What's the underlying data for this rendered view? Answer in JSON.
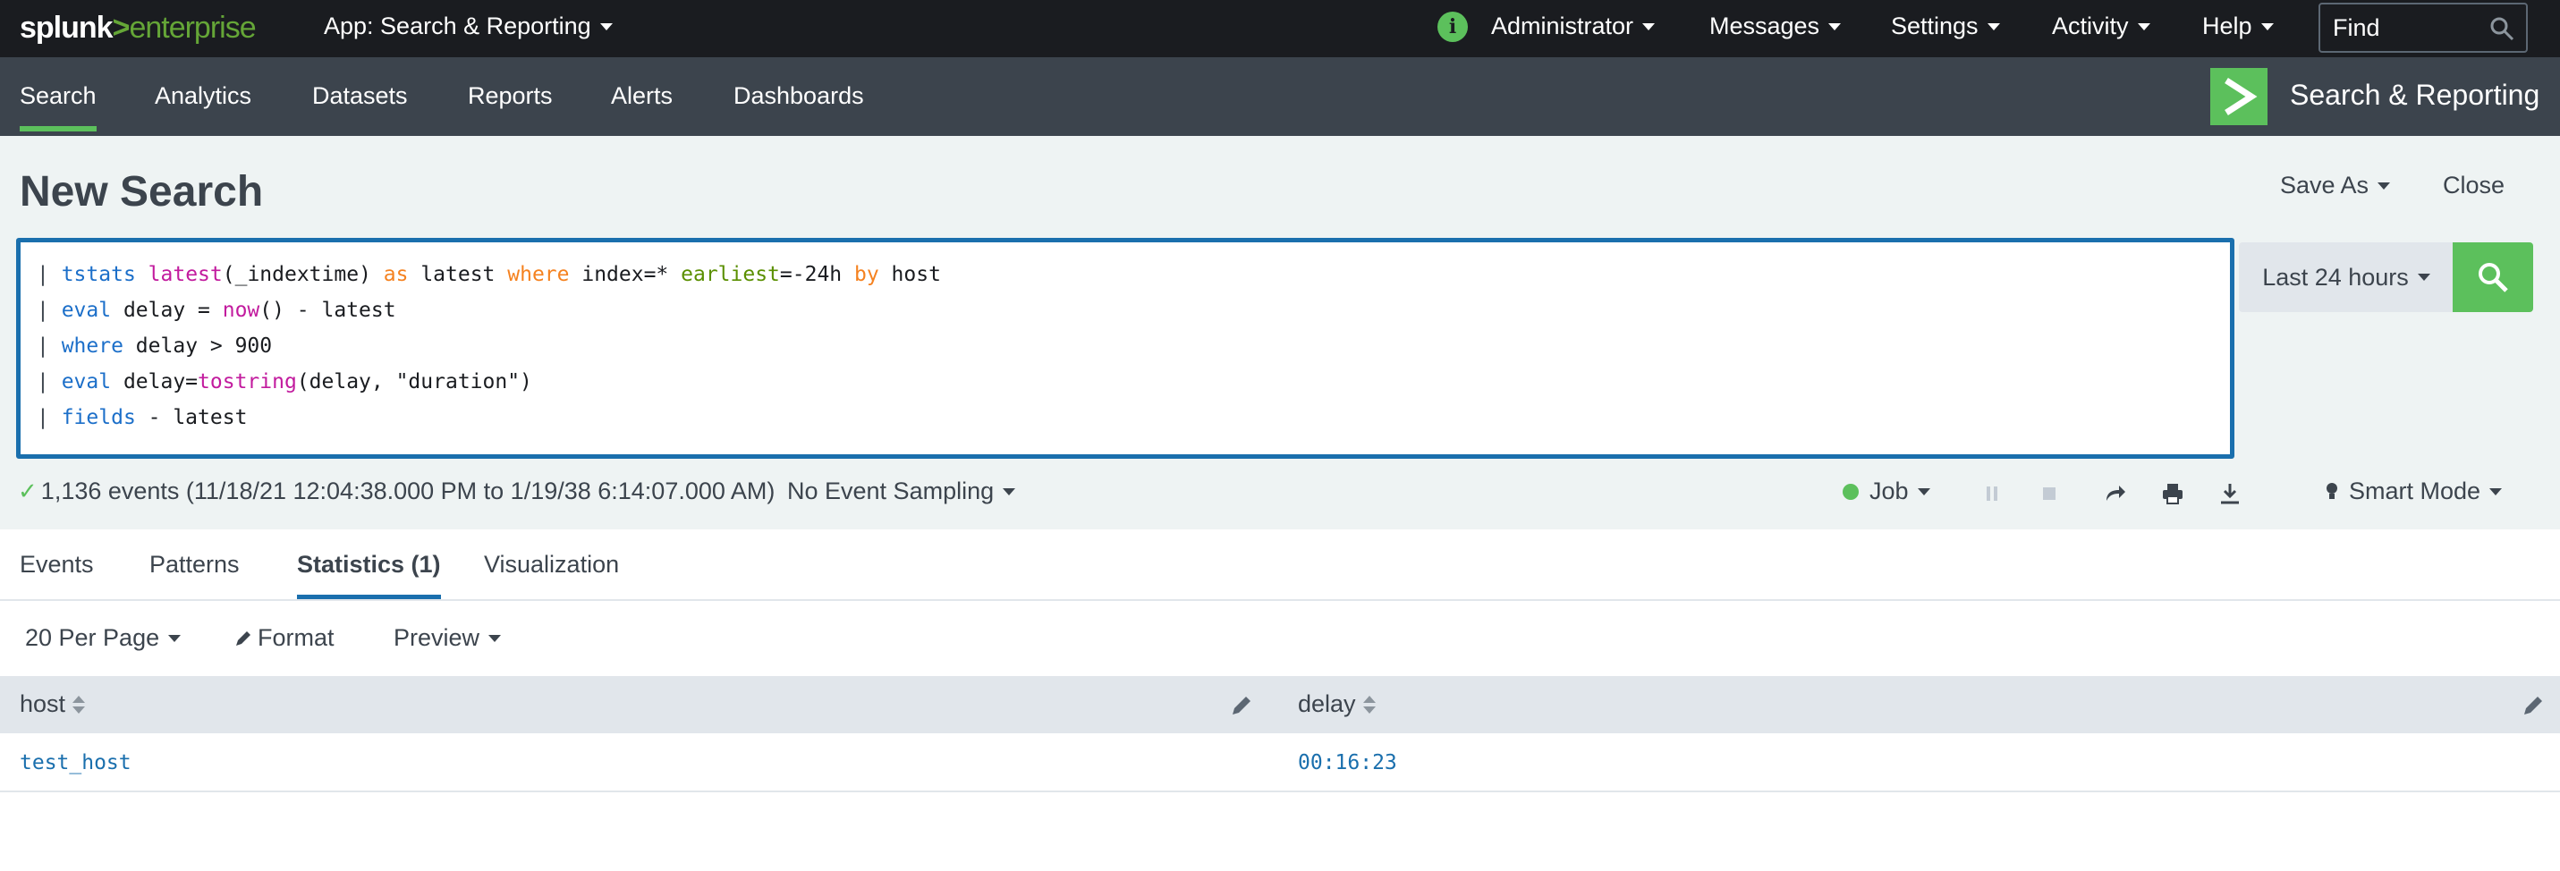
{
  "topbar": {
    "logo_part1": "splunk",
    "logo_part2": ">",
    "logo_part3": "enterprise",
    "app_menu": "App: Search & Reporting",
    "user_menu": "Administrator",
    "messages": "Messages",
    "settings": "Settings",
    "activity": "Activity",
    "help": "Help",
    "find_placeholder": "Find"
  },
  "appbar": {
    "tabs": [
      "Search",
      "Analytics",
      "Datasets",
      "Reports",
      "Alerts",
      "Dashboards"
    ],
    "active_tab": "Search",
    "app_title": "Search & Reporting"
  },
  "search": {
    "page_title": "New Search",
    "save_as": "Save As",
    "close": "Close",
    "time_range": "Last 24 hours",
    "query_lines": [
      "| tstats latest(_indextime) as latest where index=* earliest=-24h by host",
      "| eval delay = now() - latest",
      "| where delay > 900",
      "| eval delay=tostring(delay, \"duration\")",
      "| fields - latest"
    ]
  },
  "status": {
    "summary": "1,136 events (11/18/21 12:04:38.000 PM to 1/19/38 6:14:07.000 AM)",
    "sampling": "No Event Sampling",
    "job": "Job",
    "mode": "Smart Mode"
  },
  "result_tabs": [
    "Events",
    "Patterns",
    "Statistics (1)",
    "Visualization"
  ],
  "active_result_tab": "Statistics (1)",
  "table_controls": {
    "per_page": "20 Per Page",
    "format": "Format",
    "preview": "Preview"
  },
  "table": {
    "columns": [
      "host",
      "delay"
    ],
    "rows": [
      [
        "test_host",
        "00:16:23"
      ]
    ]
  },
  "colors": {
    "topbar_bg": "#1a1c20",
    "appbar_bg": "#3c444d",
    "accent_green": "#5cc05c",
    "focus_blue": "#1a6fad",
    "search_bg": "#eef3f3"
  }
}
